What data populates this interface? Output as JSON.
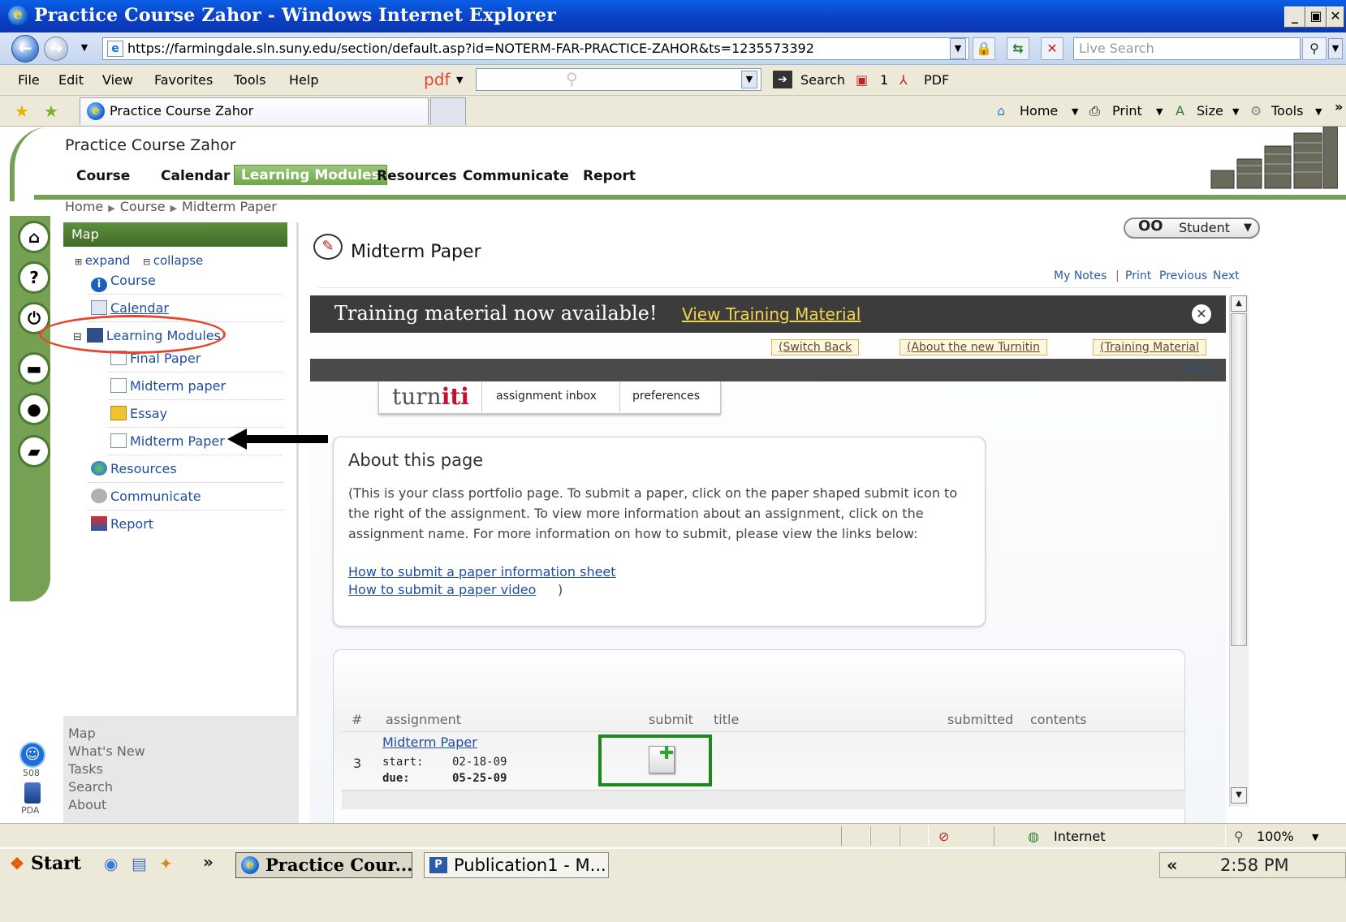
{
  "window": {
    "title": "Practice Course Zahor - Windows Internet Explorer",
    "min": "_",
    "max": "▣",
    "close": "✕"
  },
  "address": {
    "url": "https://farmingdale.sln.suny.edu/section/default.asp?id=NOTERM-FAR-PRACTICE-ZAHOR&ts=1235573392",
    "search_placeholder": "Live Search"
  },
  "menu": [
    "File",
    "Edit",
    "View",
    "Favorites",
    "Tools",
    "Help"
  ],
  "pdfbar": {
    "logo": "pdf",
    "search_label": "Search",
    "count": "1",
    "pdf_label": "PDF"
  },
  "tabs": {
    "active_label": "Practice Course Zahor"
  },
  "commands": {
    "home": "Home",
    "print": "Print",
    "size": "Size",
    "tools": "Tools"
  },
  "course": {
    "title": "Practice Course Zahor",
    "nav": [
      "Course",
      "Calendar",
      "Learning Modules",
      "Resources",
      "Communicate",
      "Report"
    ],
    "active_nav": "Learning Modules"
  },
  "breadcrumb": [
    "Home",
    "Course",
    "Midterm Paper"
  ],
  "map": {
    "header": "Map",
    "expand": "expand",
    "collapse": "collapse",
    "items": [
      "Course",
      "Calendar",
      "Learning Modules",
      "Final Paper",
      "Midterm paper",
      "Essay",
      "Midterm Paper",
      "Resources",
      "Communicate",
      "Report"
    ],
    "footer": [
      "Map",
      "What's New",
      "Tasks",
      "Search",
      "About"
    ]
  },
  "rail": {
    "label_508": "508",
    "label_pda": "PDA"
  },
  "content": {
    "role": "Student",
    "page_title": "Midterm Paper",
    "links": [
      "My Notes",
      "|",
      "Print",
      "Previous",
      "Next"
    ]
  },
  "turnitin": {
    "training_text": "Training material now available!",
    "training_link": "View Training Material",
    "buttons": [
      "(Switch Back",
      "(About the new Turnitin",
      "(Training Material"
    ],
    "help": "(help",
    "logo_a": "turn",
    "logo_b": "iti",
    "tabs": [
      "assignment inbox",
      "preferences"
    ],
    "about_title": "About this page",
    "about_body": "(This is your class portfolio page. To submit a paper, click on the paper shaped submit icon to the right of the assignment. To view more information about an assignment, click on the assignment name. For more information on how to submit, please view the links below:",
    "about_link1": "How to submit a paper information sheet",
    "about_link2": "How to submit a paper video",
    "about_link2_tail": ")",
    "table_headers": [
      "#",
      "assignment",
      "submit",
      "title",
      "submitted",
      "contents"
    ],
    "row": {
      "number": "3",
      "assignment": "Midterm Paper",
      "start_label": "start:",
      "start": "02-18-09",
      "due_label": "due:",
      "due": "05-25-09"
    }
  },
  "status": {
    "zone": "Internet",
    "zoom": "100%"
  },
  "taskbar": {
    "start": "Start",
    "tasks": [
      "Practice Cour...",
      "Publication1 - M..."
    ],
    "chevron": "»",
    "tray_chevron": "«",
    "time": "2:58 PM"
  },
  "colors": {
    "brand_green": "#76a155",
    "annotation_red": "#e8452b",
    "highlight_green": "#1a8a1a"
  }
}
